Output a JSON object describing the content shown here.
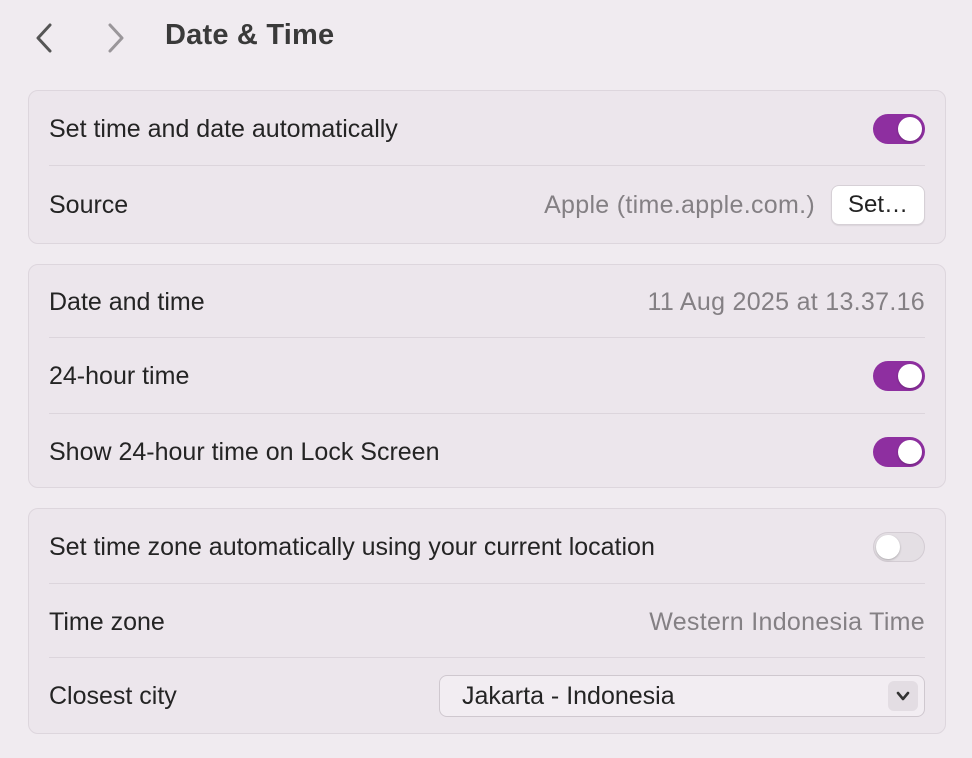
{
  "header": {
    "title": "Date & Time",
    "back_icon": "chevron-left-icon",
    "forward_icon": "chevron-right-icon"
  },
  "group_auto": {
    "set_auto": {
      "label": "Set time and date automatically",
      "enabled": true
    },
    "source": {
      "label": "Source",
      "value": "Apple (time.apple.com.)",
      "button_label": "Set…"
    }
  },
  "group_datetime": {
    "date_time": {
      "label": "Date and time",
      "value": "11 Aug 2025 at 13.37.16"
    },
    "hour24": {
      "label": "24-hour time",
      "enabled": true
    },
    "lock_screen": {
      "label": "Show 24-hour time on Lock Screen",
      "enabled": true
    }
  },
  "group_timezone": {
    "auto_zone": {
      "label": "Set time zone automatically using your current location",
      "enabled": false
    },
    "time_zone": {
      "label": "Time zone",
      "value": "Western Indonesia Time"
    },
    "closest_city": {
      "label": "Closest city",
      "selected": "Jakarta - Indonesia"
    }
  },
  "colors": {
    "accent": "#8e2fa0",
    "background": "#f0ebf0",
    "group_bg": "#ece6ec"
  }
}
